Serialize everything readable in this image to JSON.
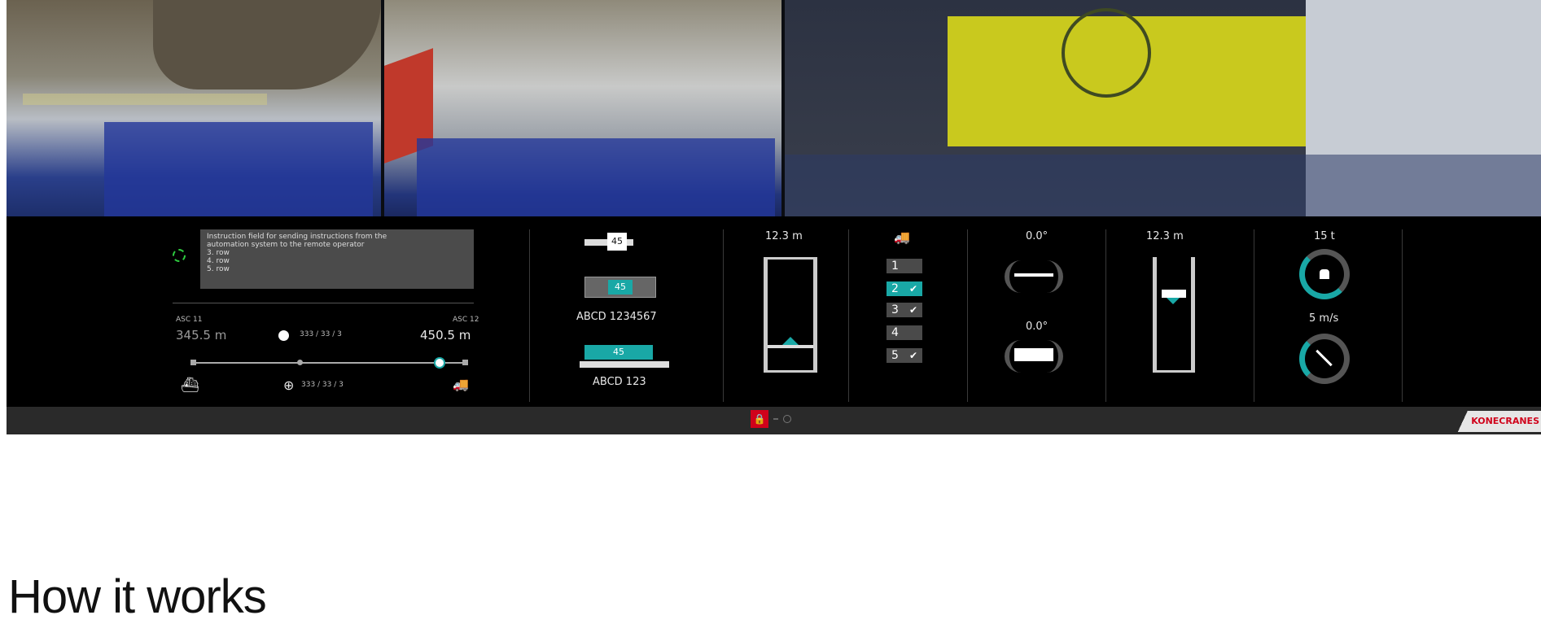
{
  "instruction": {
    "lines": [
      "Instruction field for sending instructions from the",
      "automation system to the remote operator",
      "3. row",
      "4. row",
      "5. row"
    ]
  },
  "gantry": {
    "left_label": "ASC 11",
    "right_label": "ASC 12",
    "left_distance": "345.5 m",
    "right_distance": "450.5 m",
    "marker_top": "333 / 33 / 3",
    "marker_bottom": "333 / 33 / 3"
  },
  "container": {
    "spreader_size": "45",
    "container_size": "45",
    "container_id": "ABCD 1234567",
    "truck_size": "45",
    "truck_id": "ABCD 123"
  },
  "hoist_left": {
    "height": "12.3 m"
  },
  "rows": [
    {
      "label": "1",
      "checked": false
    },
    {
      "label": "2",
      "checked": true
    },
    {
      "label": "3",
      "checked": true
    },
    {
      "label": "4",
      "checked": false
    },
    {
      "label": "5",
      "checked": true
    }
  ],
  "angles": {
    "trim": "0.0°",
    "skew": "0.0°"
  },
  "hoist_right": {
    "height": "12.3 m"
  },
  "load": {
    "weight": "15 t",
    "speed": "5 m/s"
  },
  "brand": "KONECRANES",
  "heading": "How it works"
}
